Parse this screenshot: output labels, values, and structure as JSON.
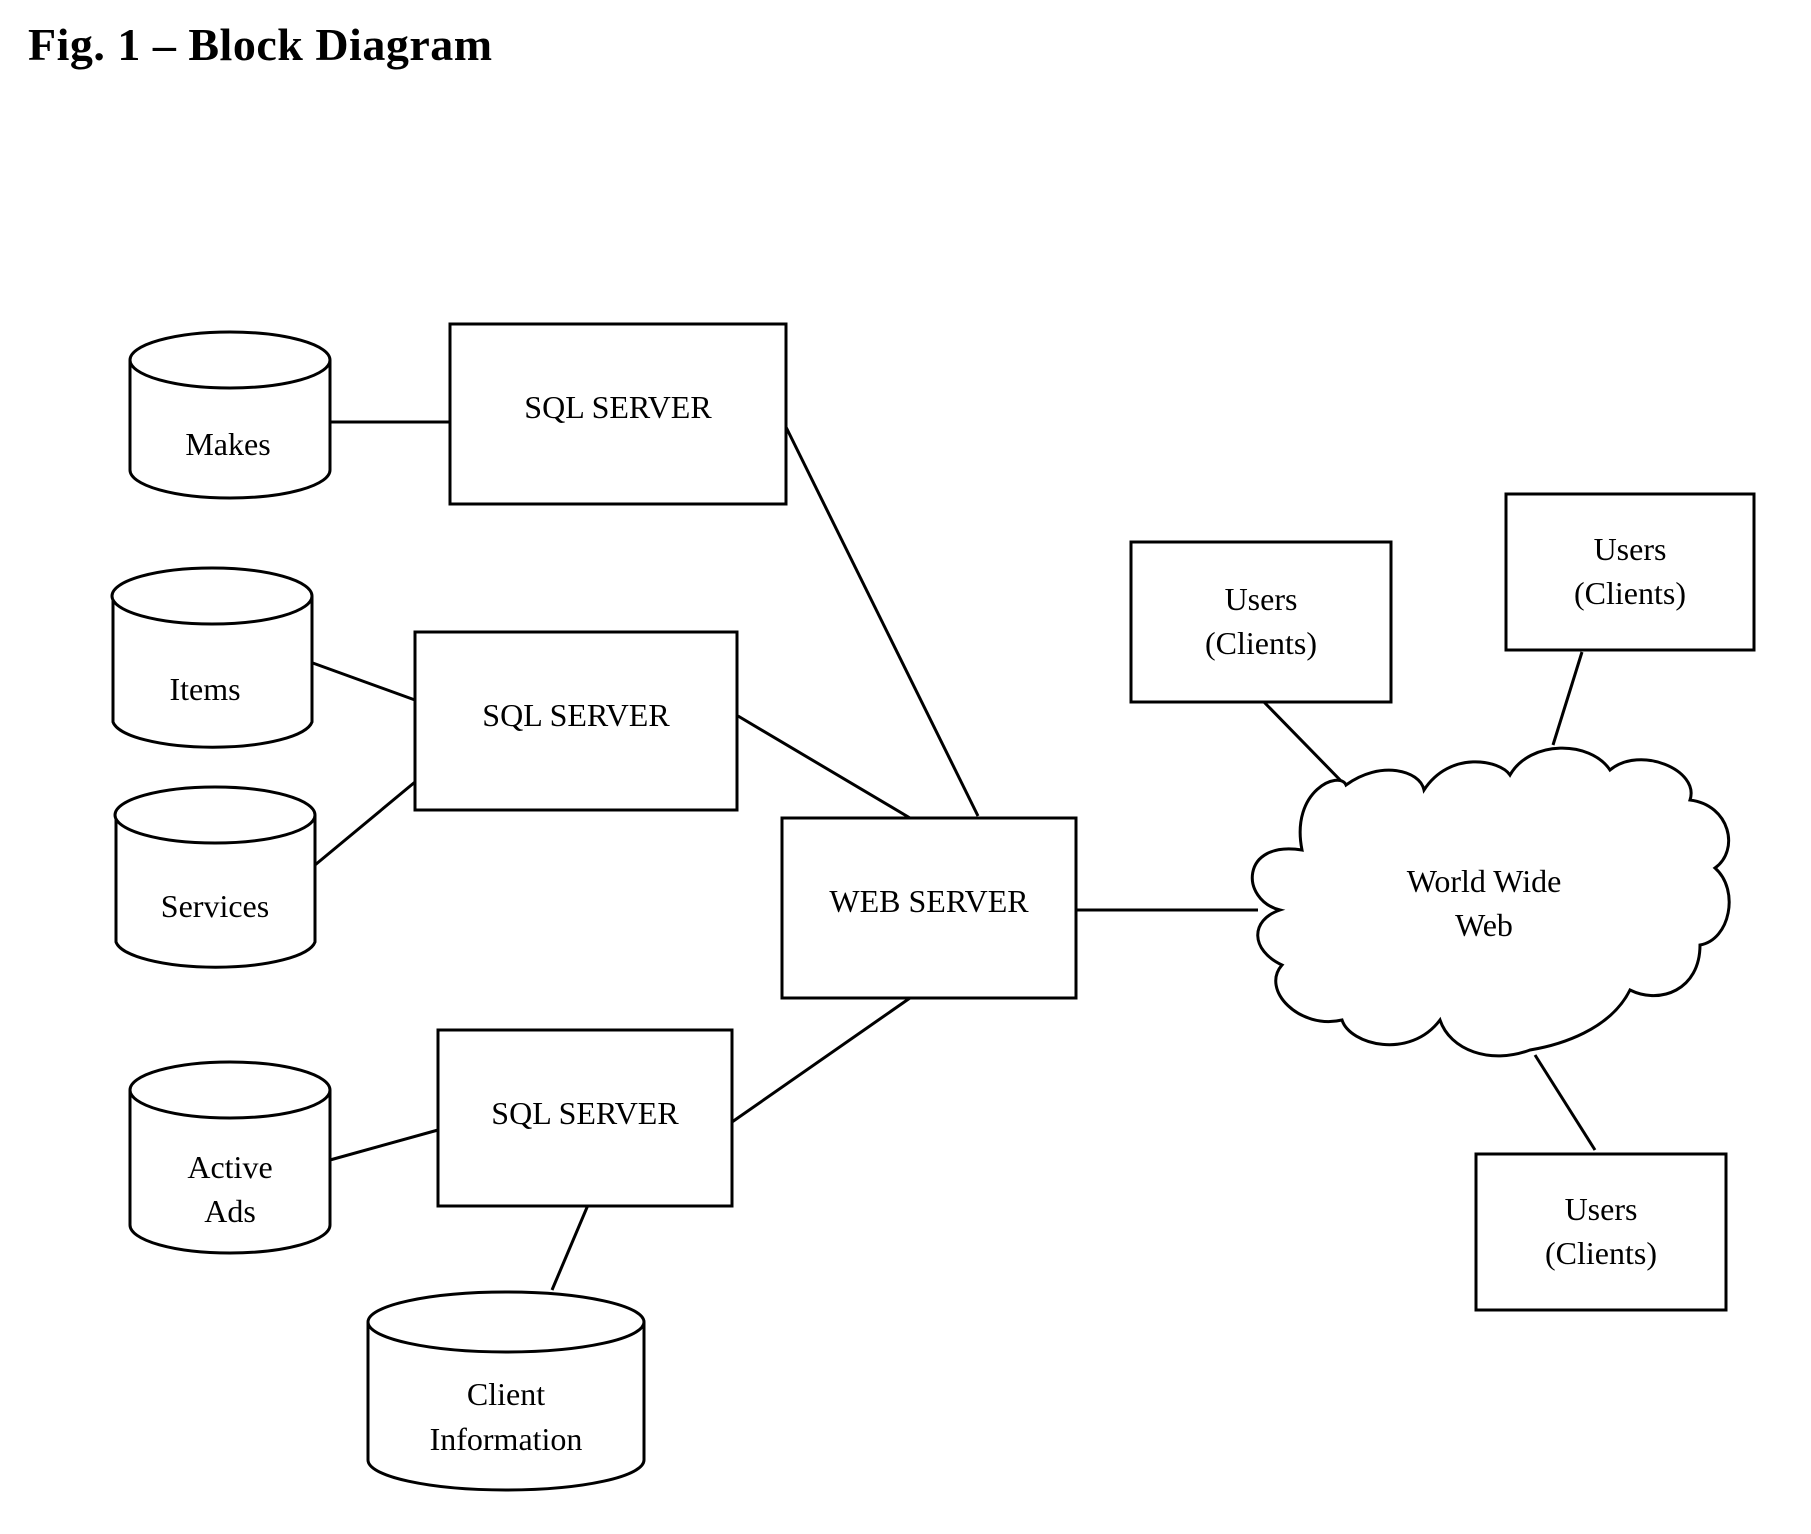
{
  "title": "Fig. 1 – Block Diagram",
  "nodes": {
    "db_makes": {
      "lines": [
        "Makes"
      ],
      "type": "database"
    },
    "db_items": {
      "lines": [
        "Items"
      ],
      "type": "database"
    },
    "db_services": {
      "lines": [
        "Services"
      ],
      "type": "database"
    },
    "db_active_ads": {
      "lines": [
        "Active",
        "Ads"
      ],
      "type": "database"
    },
    "db_client_info": {
      "lines": [
        "Client",
        "Information"
      ],
      "type": "database"
    },
    "sql_server_1": {
      "lines": [
        "SQL SERVER"
      ],
      "type": "box"
    },
    "sql_server_2": {
      "lines": [
        "SQL SERVER"
      ],
      "type": "box"
    },
    "sql_server_3": {
      "lines": [
        "SQL SERVER"
      ],
      "type": "box"
    },
    "web_server": {
      "lines": [
        "WEB SERVER"
      ],
      "type": "box"
    },
    "www": {
      "lines": [
        "World Wide",
        "Web"
      ],
      "type": "cloud"
    },
    "users_1": {
      "lines": [
        "Users",
        "(Clients)"
      ],
      "type": "box"
    },
    "users_2": {
      "lines": [
        "Users",
        "(Clients)"
      ],
      "type": "box"
    },
    "users_3": {
      "lines": [
        "Users",
        "(Clients)"
      ],
      "type": "box"
    }
  },
  "edges": [
    [
      "db_makes",
      "sql_server_1"
    ],
    [
      "db_items",
      "sql_server_2"
    ],
    [
      "db_services",
      "sql_server_2"
    ],
    [
      "db_active_ads",
      "sql_server_3"
    ],
    [
      "sql_server_3",
      "db_client_info"
    ],
    [
      "sql_server_1",
      "web_server"
    ],
    [
      "sql_server_2",
      "web_server"
    ],
    [
      "sql_server_3",
      "web_server"
    ],
    [
      "web_server",
      "www"
    ],
    [
      "users_1",
      "www"
    ],
    [
      "users_2",
      "www"
    ],
    [
      "www",
      "users_3"
    ]
  ]
}
